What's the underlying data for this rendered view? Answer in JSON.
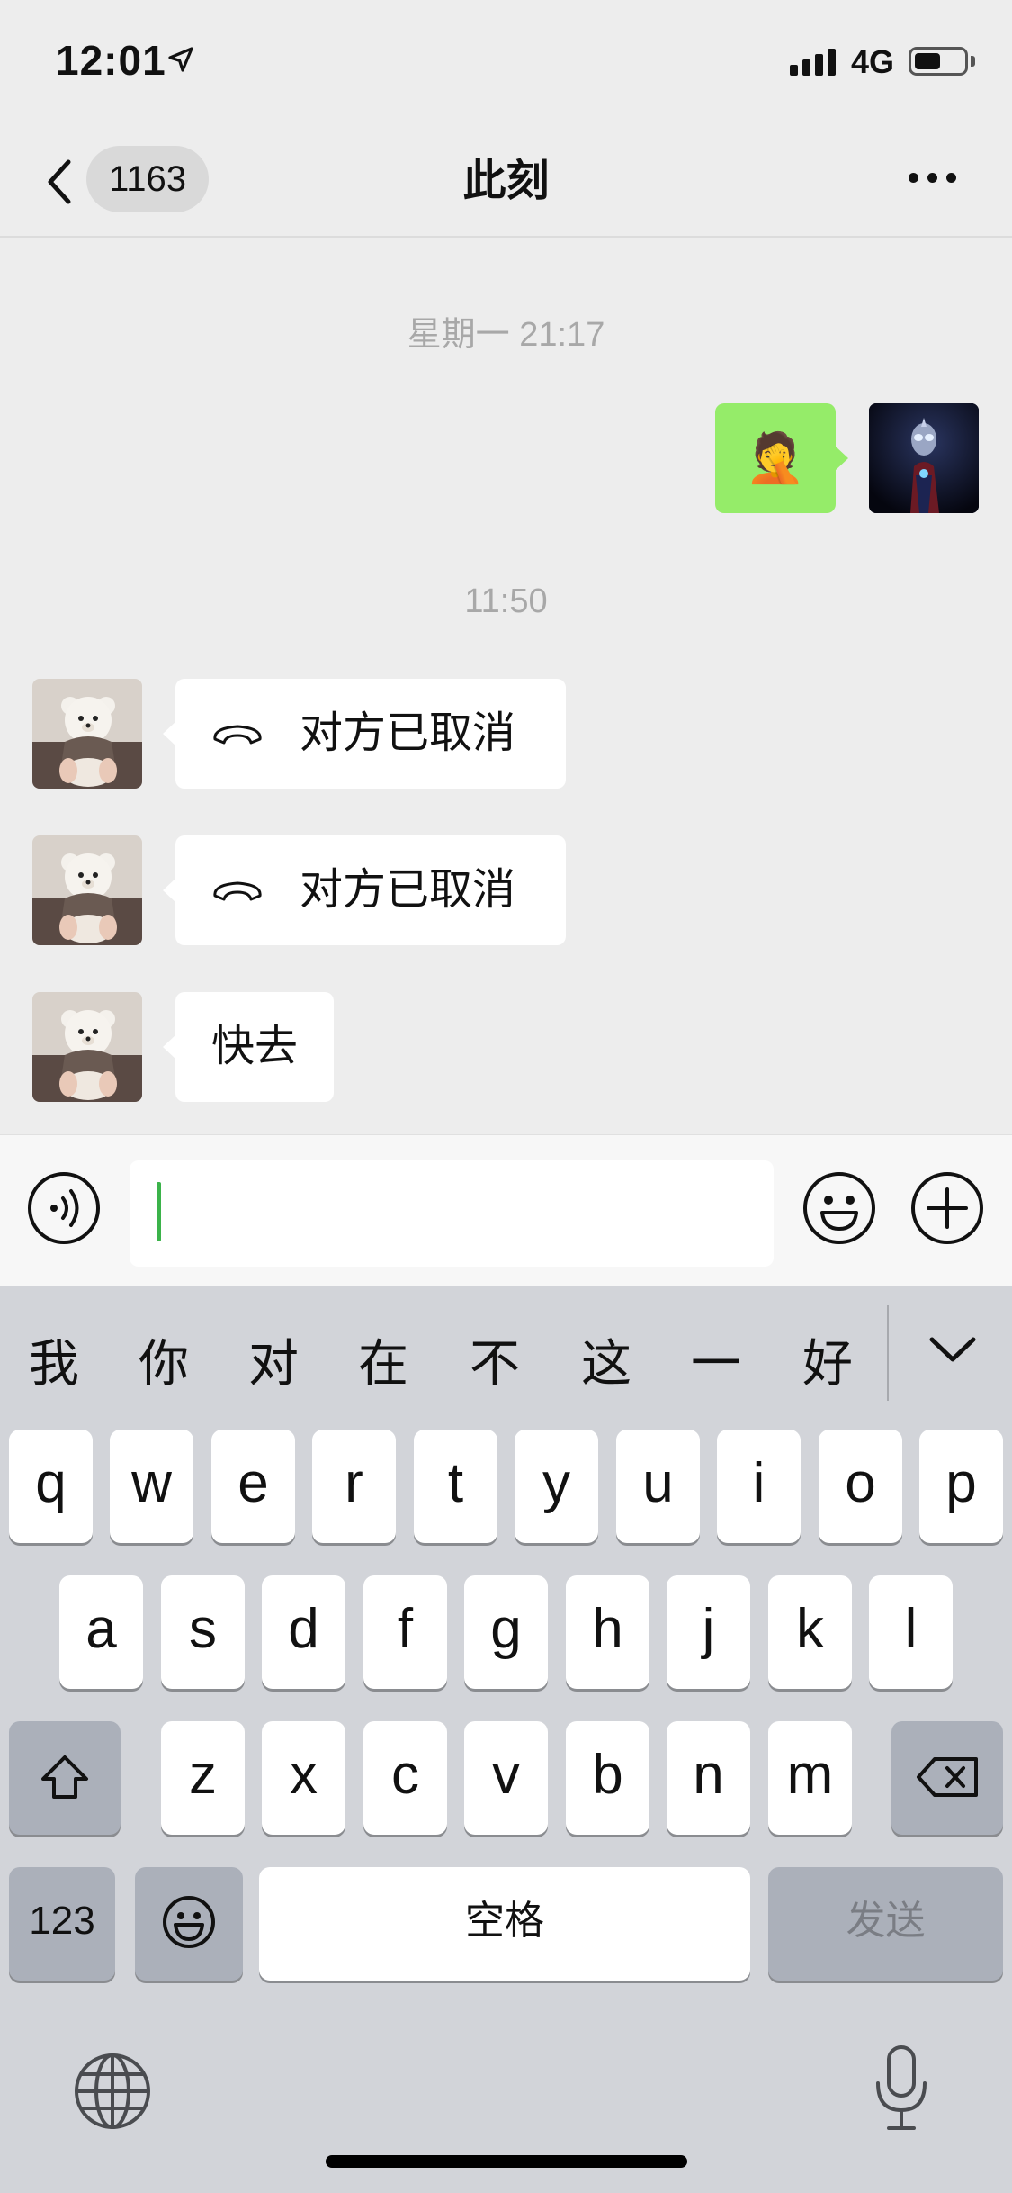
{
  "status_bar": {
    "time": "12:01",
    "network": "4G",
    "icons": [
      "location-arrow-icon",
      "signal-icon",
      "battery-icon"
    ]
  },
  "nav": {
    "back_icon": "chevron-left-icon",
    "unread_count": "1163",
    "title": "此刻",
    "more_icon": "ellipsis-icon"
  },
  "messages": {
    "stamp1": "星期一 21:17",
    "sent_emoji": "🤦",
    "stamp2": "11:50",
    "recv1": "对方已取消",
    "recv2": "对方已取消",
    "recv3": "快去"
  },
  "input": {
    "value": "",
    "icons": [
      "voice-icon",
      "emoji-icon",
      "plus-icon"
    ]
  },
  "keyboard": {
    "candidates": [
      "我",
      "你",
      "对",
      "在",
      "不",
      "这",
      "一",
      "好"
    ],
    "row1": [
      "q",
      "w",
      "e",
      "r",
      "t",
      "y",
      "u",
      "i",
      "o",
      "p"
    ],
    "row2": [
      "a",
      "s",
      "d",
      "f",
      "g",
      "h",
      "j",
      "k",
      "l"
    ],
    "row3": [
      "z",
      "x",
      "c",
      "v",
      "b",
      "n",
      "m"
    ],
    "numbers_key": "123",
    "space_key": "空格",
    "send_key": "发送"
  },
  "colors": {
    "sent_bubble": "#95ec69",
    "background": "#ededed",
    "caret": "#3bb34a"
  }
}
